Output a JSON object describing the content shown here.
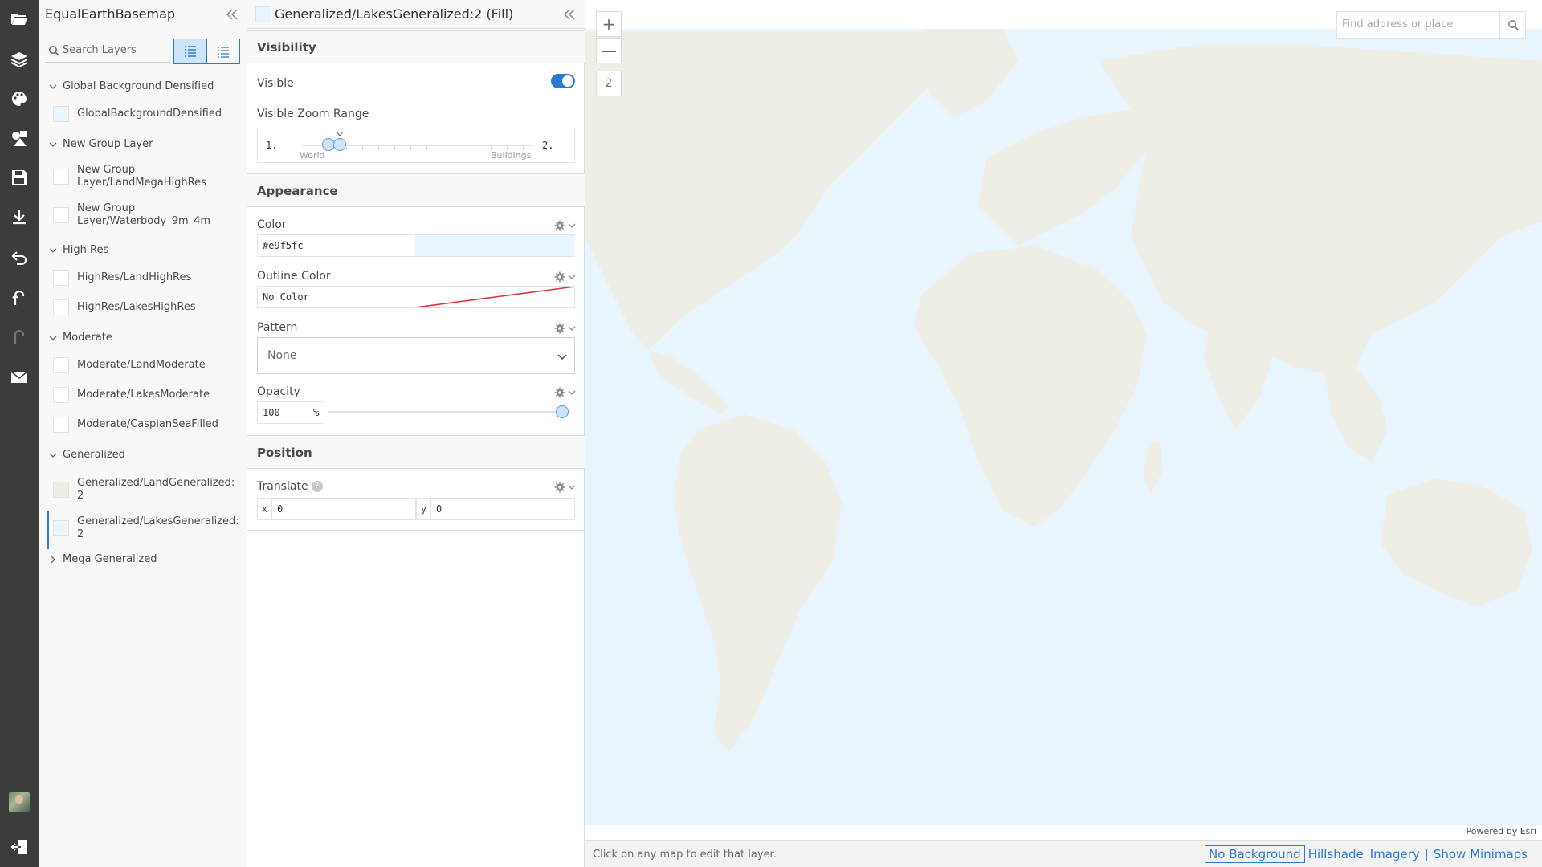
{
  "rail": {
    "icons": [
      "folder-icon",
      "layers-icon",
      "paint-palette-icon",
      "shapes-icon",
      "save-icon",
      "download-icon",
      "undo-icon",
      "return-icon",
      "redo-icon",
      "mail-icon",
      "avatar",
      "sign-out-icon"
    ]
  },
  "layers_panel": {
    "title": "EqualEarthBasemap",
    "search_placeholder": "Search Layers",
    "groups": {
      "global": {
        "label": "Global Background Densified",
        "items": [
          "GlobalBackgroundDensified"
        ]
      },
      "newgroup": {
        "label": "New Group Layer",
        "items": [
          "New Group Layer/LandMegaHighRes",
          "New Group Layer/Waterbody_9m_4m"
        ]
      },
      "highres": {
        "label": "High Res",
        "items": [
          "HighRes/LandHighRes",
          "HighRes/LakesHighRes"
        ]
      },
      "moderate": {
        "label": "Moderate",
        "items": [
          "Moderate/LandModerate",
          "Moderate/LakesModerate",
          "Moderate/CaspianSeaFilled"
        ]
      },
      "generalized": {
        "label": "Generalized",
        "items": [
          "Generalized/LandGeneralized: 2",
          "Generalized/LakesGeneralized: 2"
        ]
      },
      "mega": {
        "label": "Mega Generalized"
      }
    }
  },
  "editor": {
    "title": "Generalized/LakesGeneralized:2 (Fill)",
    "sections": {
      "visibility": "Visibility",
      "appearance": "Appearance",
      "position": "Position"
    },
    "visible_label": "Visible",
    "visible_on": true,
    "zoom_range_label": "Visible Zoom Range",
    "zoom_min": "1.",
    "zoom_max": "2.",
    "zoom_world": "World",
    "zoom_buildings": "Buildings",
    "color_label": "Color",
    "color_value": "#e9f5fc",
    "outline_label": "Outline Color",
    "outline_value": "No Color",
    "pattern_label": "Pattern",
    "pattern_value": "None",
    "opacity_label": "Opacity",
    "opacity_value": "100",
    "opacity_unit": "%",
    "translate_label": "Translate",
    "translate_help": "?",
    "x_label": "x",
    "x_value": "0",
    "y_label": "y",
    "y_value": "0"
  },
  "map": {
    "zoom_in": "+",
    "zoom_out": "—",
    "zoom_level": "2",
    "find_placeholder": "Find address or place",
    "attribution": "Powered by Esri",
    "status_text": "Click on any map to edit that layer.",
    "bg_options": [
      "No Background",
      "Hillshade",
      "Imagery",
      "Show Minimaps"
    ],
    "bg_separator": "|",
    "water_color": "#e9f5fc",
    "land_color": "#eeeee6"
  }
}
